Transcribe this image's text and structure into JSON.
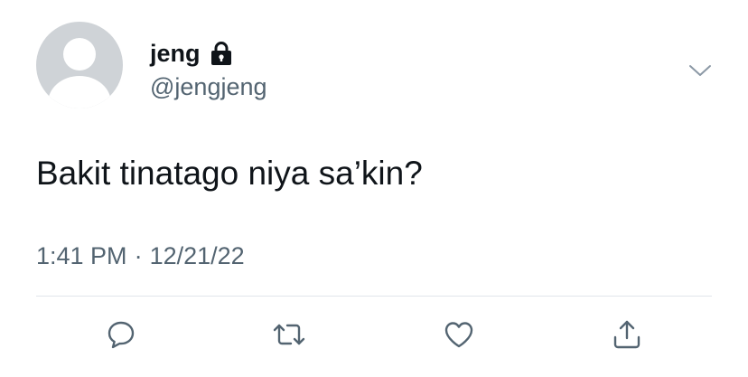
{
  "tweet": {
    "display_name": "jeng",
    "handle": "@jengjeng",
    "text": "Bakit tinatago niya sa’kin?",
    "time": "1:41 PM",
    "separator": "·",
    "date": "12/21/22",
    "is_protected": true
  },
  "icons": {
    "avatar": "default-avatar",
    "lock": "lock-icon",
    "caret": "chevron-down-icon",
    "reply": "reply-icon",
    "retweet": "retweet-icon",
    "like": "heart-icon",
    "share": "share-icon"
  },
  "colors": {
    "text_primary": "#0f1419",
    "text_secondary": "#536471",
    "icon_gray": "#536471",
    "divider": "#e1e6ea",
    "avatar_bg": "#cfd3d7"
  }
}
